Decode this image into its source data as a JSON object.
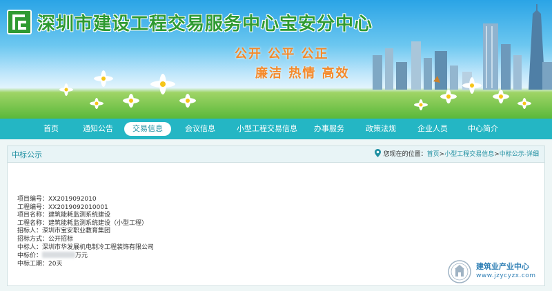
{
  "header": {
    "site_title": "深圳市建设工程交易服务中心宝安分中心",
    "slogan_line1": "公开 公平 公正",
    "slogan_line2": "廉洁 热情 高效",
    "logo_icon": "building-logo-icon",
    "colors": {
      "title": "#2f9a32",
      "slogan": "#f4892a",
      "nav": "#24b6c4"
    }
  },
  "nav": {
    "items": [
      {
        "label": "首页"
      },
      {
        "label": "通知公告"
      },
      {
        "label": "交易信息",
        "active": true
      },
      {
        "label": "会议信息"
      },
      {
        "label": "小型工程交易信息"
      },
      {
        "label": "办事服务"
      },
      {
        "label": "政策法规"
      },
      {
        "label": "企业人员"
      },
      {
        "label": "中心简介"
      }
    ]
  },
  "panel": {
    "title": "中标公示",
    "breadcrumb": {
      "prefix": "您现在的位置：",
      "home": "首页",
      "sep1": ">",
      "section": "小型工程交易信息",
      "sep2": ">",
      "current": "中标公示-详细"
    }
  },
  "details": [
    {
      "label": "项目编号：",
      "value": "XX2019092010"
    },
    {
      "label": "工程编号：",
      "value": "XX2019092010001"
    },
    {
      "label": "项目名称：",
      "value": "建筑能耗监测系统建设"
    },
    {
      "label": "工程名称：",
      "value": "建筑能耗监测系统建设（小型工程）"
    },
    {
      "label": "招标人：",
      "value": "深圳市宝安职业教育集团"
    },
    {
      "label": "招标方式：",
      "value": "公开招标"
    },
    {
      "label": "中标人：",
      "value": "深圳市华发展机电制冷工程装饰有限公司"
    },
    {
      "label": "中标价：",
      "value": "万元",
      "redacted": true
    },
    {
      "label": "中标工期：",
      "value": "20天"
    }
  ],
  "watermark": {
    "name": "建筑业产业中心",
    "url": "www.jzycyzx.com"
  }
}
